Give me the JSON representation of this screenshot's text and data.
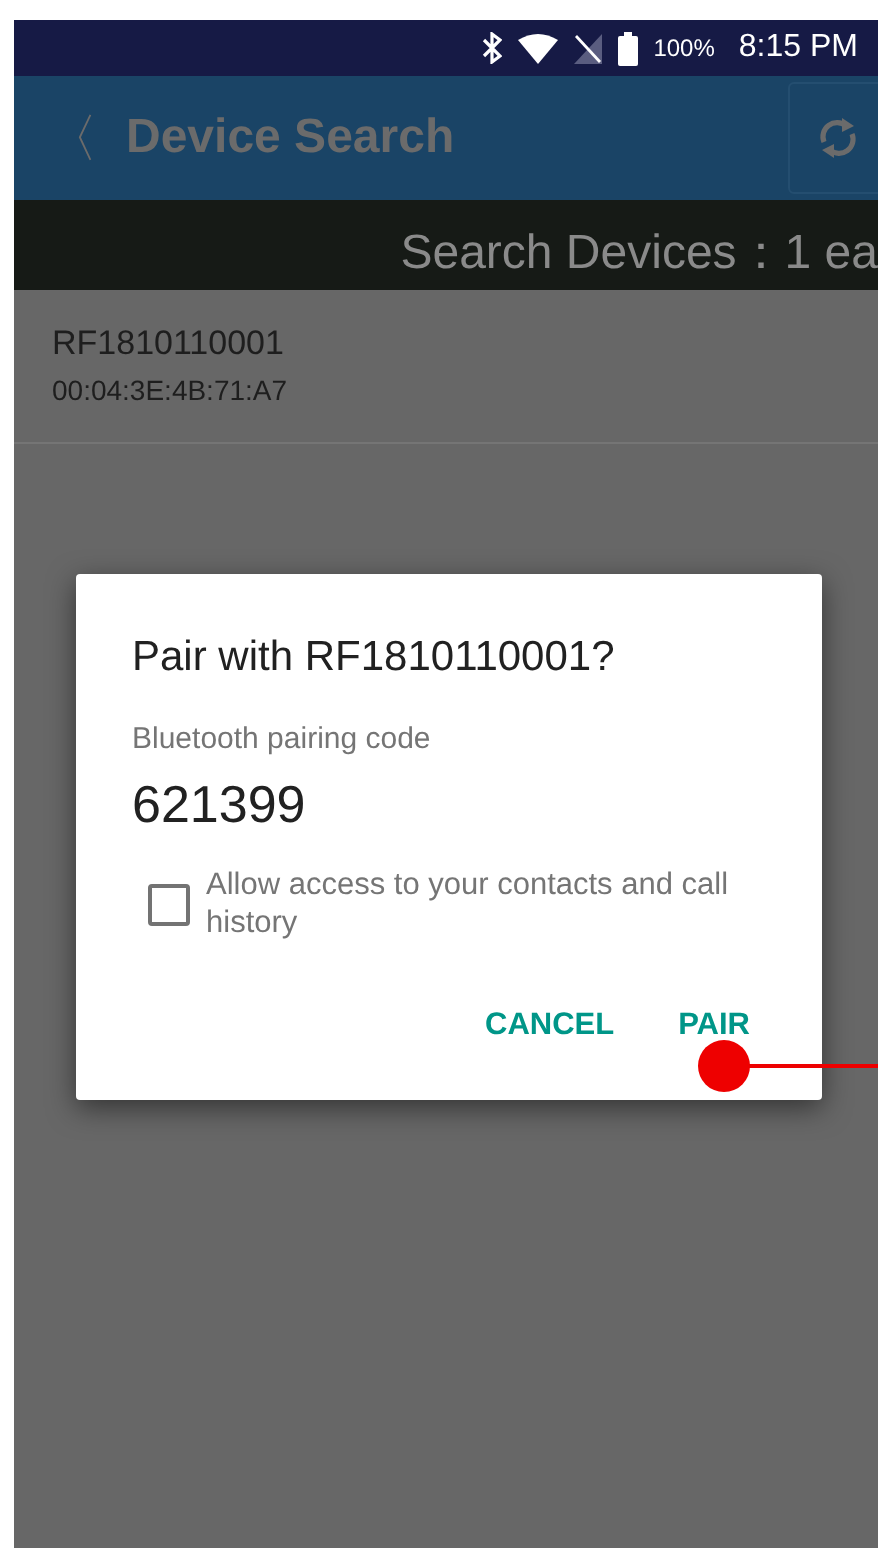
{
  "status_bar": {
    "battery": "100%",
    "time": "8:15 PM"
  },
  "toolbar": {
    "back": "〈",
    "title": "Device Search"
  },
  "search_summary": "Search Devices：1 ea",
  "devices": [
    {
      "name": "RF1810110001",
      "address": "00:04:3E:4B:71:A7"
    }
  ],
  "dialog": {
    "title": "Pair with RF1810110001?",
    "code_label": "Bluetooth pairing code",
    "code": "621399",
    "checkbox": {
      "label": "Allow access to your contacts and call history",
      "checked": false
    },
    "buttons": [
      "CANCEL",
      "PAIR"
    ]
  }
}
